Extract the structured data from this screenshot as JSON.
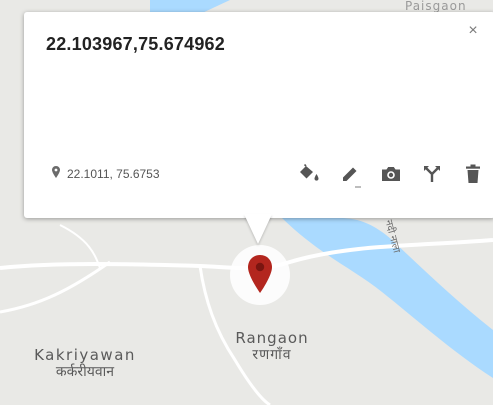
{
  "map": {
    "places": [
      {
        "name": "Rangaon",
        "native": "रणगाँव"
      },
      {
        "name": "Kakriyawan",
        "native": "कर्करीयवान"
      },
      {
        "name": "Paisgaon"
      }
    ],
    "river_label": "नदी नाला",
    "colors": {
      "land": "#e9e9e6",
      "water": "#aadaff",
      "road": "#ffffff",
      "marker": "#b3261e"
    }
  },
  "marker": {
    "icon": "map-pin-icon",
    "color": "#b3261e"
  },
  "infowindow": {
    "title": "22.103967,75.674962",
    "close_symbol": "×",
    "coordinates": "22.1011, 75.6753",
    "tools": [
      {
        "icon": "paint-bucket-icon",
        "label": "Style"
      },
      {
        "icon": "pencil-icon",
        "label": "Edit"
      },
      {
        "icon": "camera-icon",
        "label": "Add image"
      },
      {
        "icon": "directions-icon",
        "label": "Directions"
      },
      {
        "icon": "trash-icon",
        "label": "Delete"
      }
    ]
  }
}
